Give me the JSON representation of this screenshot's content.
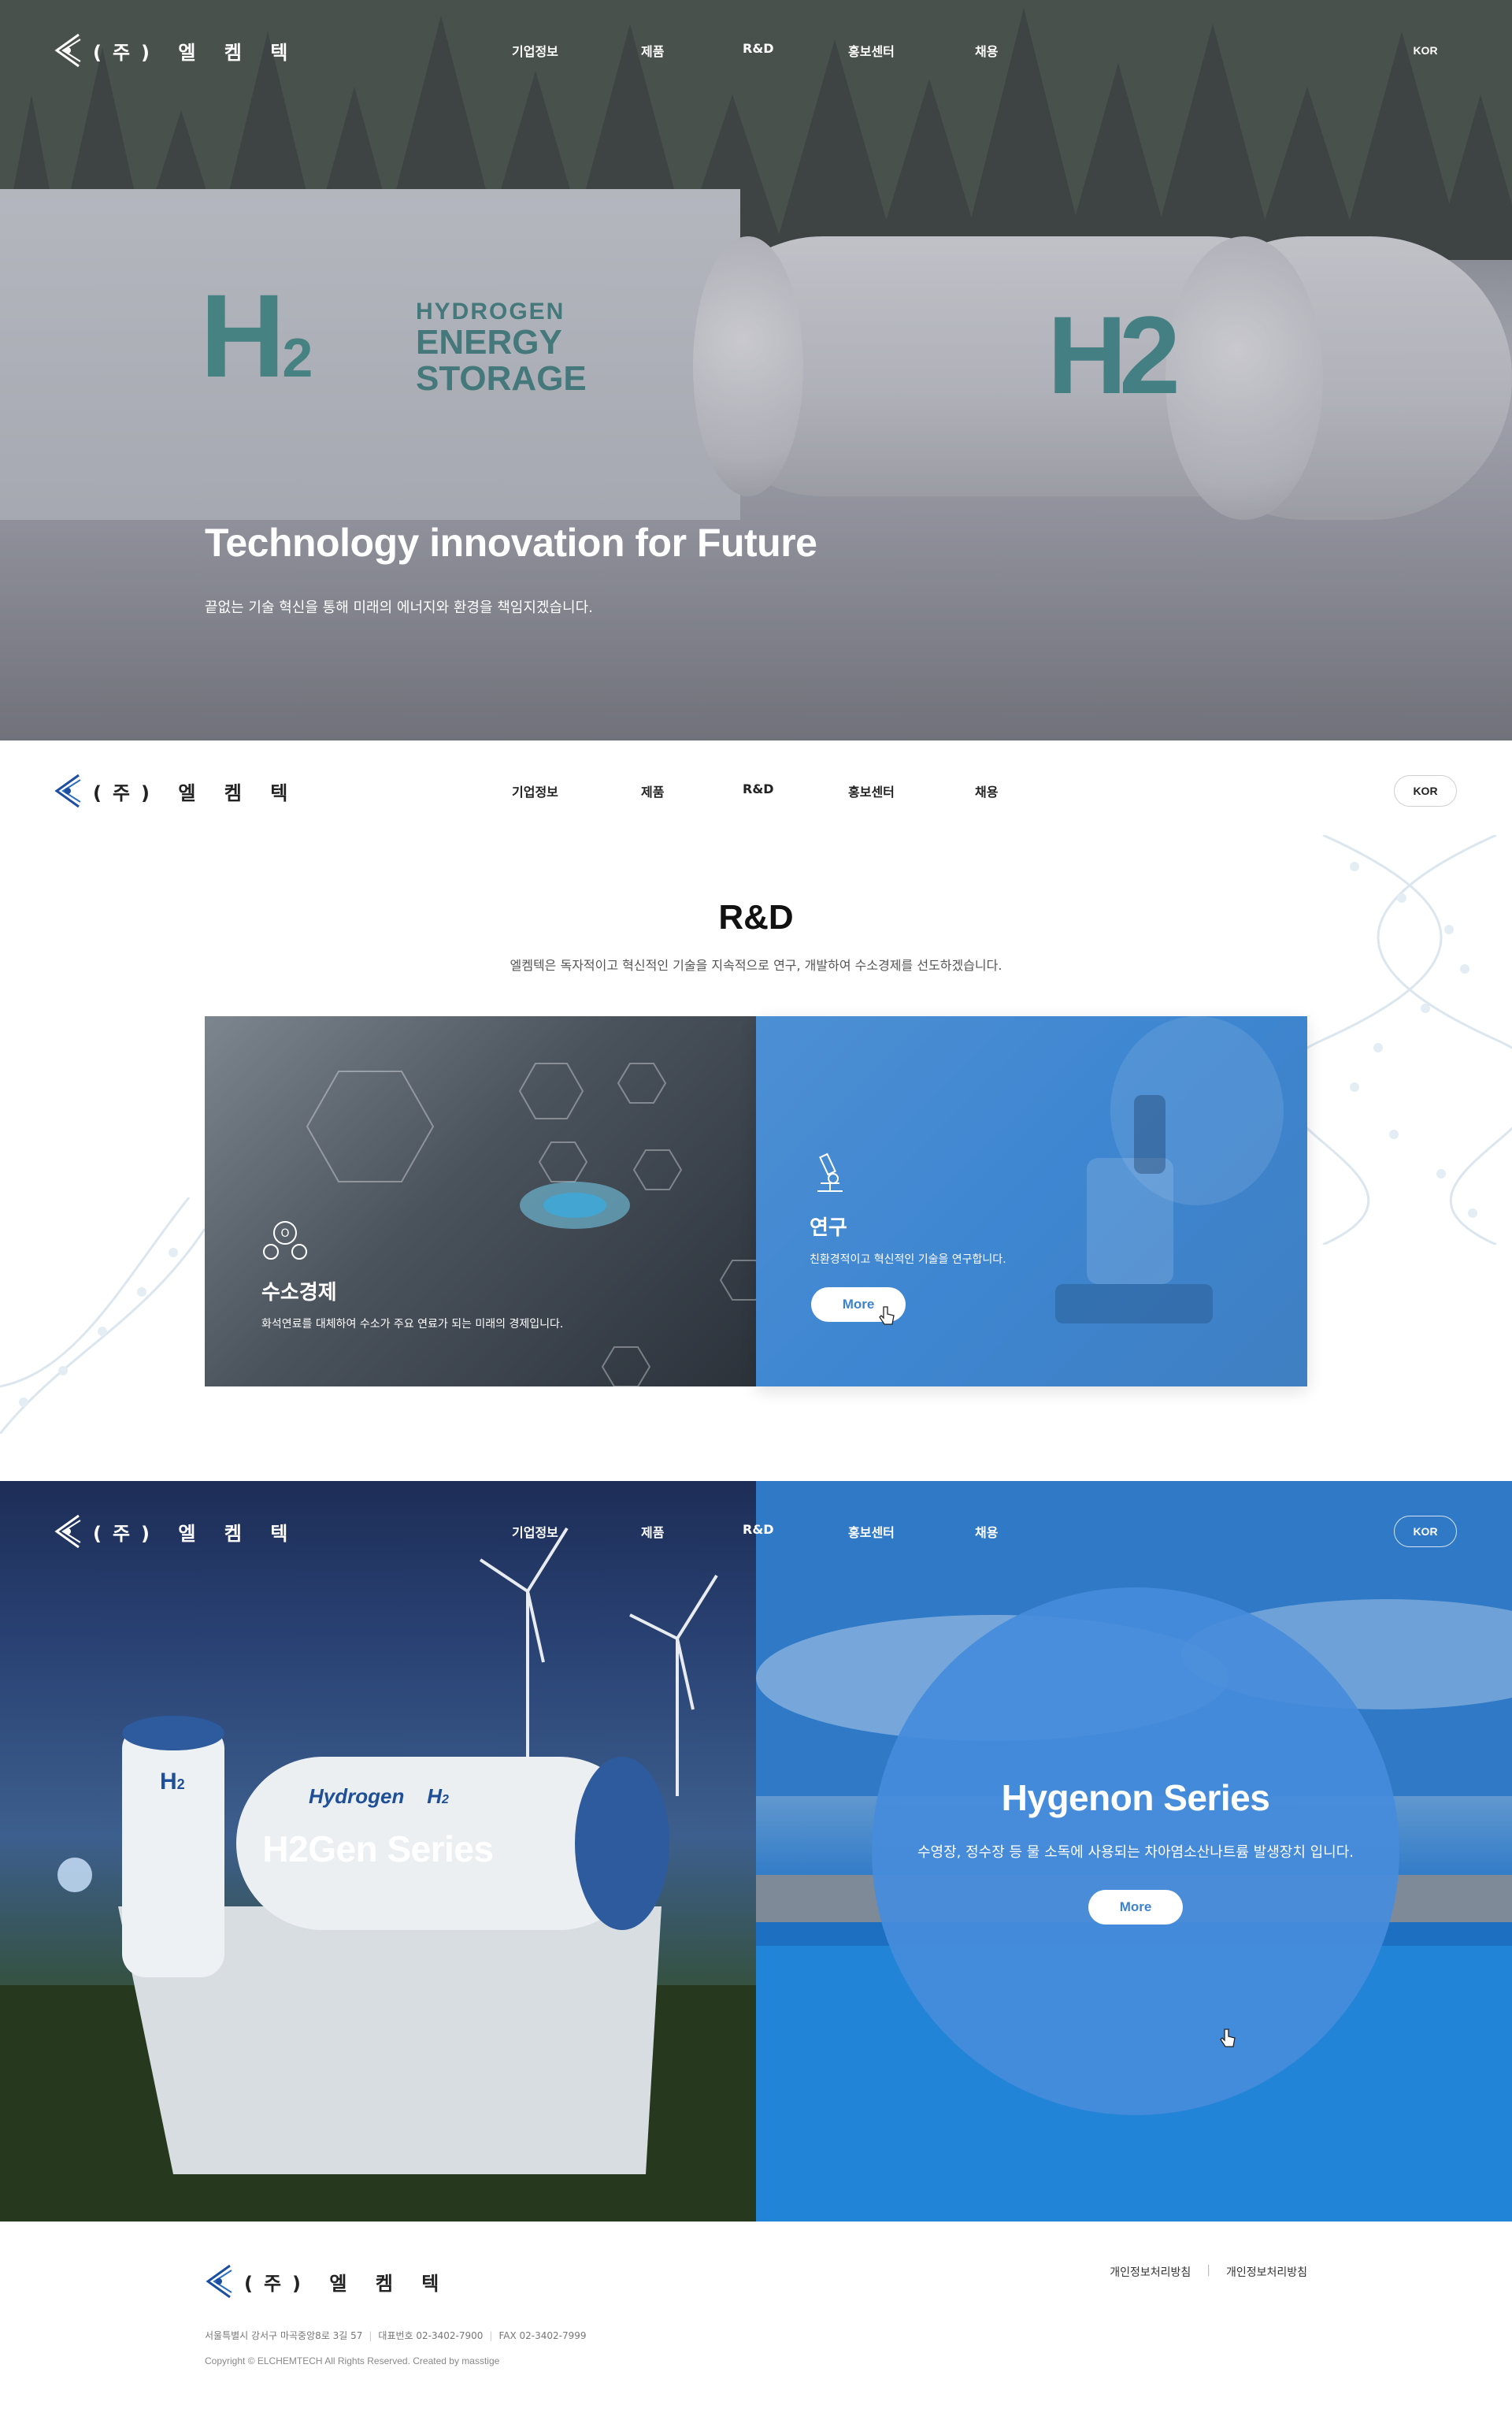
{
  "brand": {
    "name": "(주) 엘 켐 텍"
  },
  "nav": {
    "items": [
      "기업정보",
      "제품",
      "R&D",
      "홍보센터",
      "채용"
    ],
    "lang": "KOR"
  },
  "hero": {
    "title": "Technology innovation for Future",
    "subtitle": "끝없는 기술 혁신을 통해 미래의 에너지와 환경을 책임지겠습니다.",
    "image_text": {
      "h2_logo": "H",
      "h2_sub": "2",
      "hydrogen": "HYDROGEN",
      "energy": "ENERGY",
      "storage": "STORAGE",
      "tank_label": "H2"
    }
  },
  "rnd": {
    "title": "R&D",
    "subtitle": "엘켐텍은 독자적이고 혁신적인 기술을 지속적으로 연구, 개발하여 수소경제를 선도하겠습니다.",
    "cards": [
      {
        "icon": "hydrogen-molecule-icon",
        "title": "수소경제",
        "desc": "화석연료를 대체하여 수소가 주요 연료가 되는 미래의 경제입니다."
      },
      {
        "icon": "microscope-icon",
        "title": "연구",
        "desc": "친환경적이고 혁신적인 기술을 연구합니다.",
        "button": "More"
      }
    ]
  },
  "series": {
    "left": {
      "title": "H2Gen Series",
      "image_text": {
        "hydrogen": "Hydrogen",
        "h2": "H",
        "h2_sub": "2"
      }
    },
    "right": {
      "title": "Hygenon Series",
      "desc": "수영장, 정수장 등 물 소독에 사용되는 차아염소산나트륨 발생장치 입니다.",
      "button": "More"
    }
  },
  "footer": {
    "links": [
      "개인정보처리방침",
      "개인정보처리방침"
    ],
    "address": "서울특별시 강서구 마곡중앙8로 3길 57",
    "phone": "대표번호 02-3402-7900",
    "fax": "FAX 02-3402-7999",
    "copyright": "Copyright © ELCHEMTECH All Rights Reserved. Created by masstige"
  },
  "colors": {
    "accent": "#3e86d1",
    "primary_text": "#222222",
    "teal": "#2f8f86"
  }
}
